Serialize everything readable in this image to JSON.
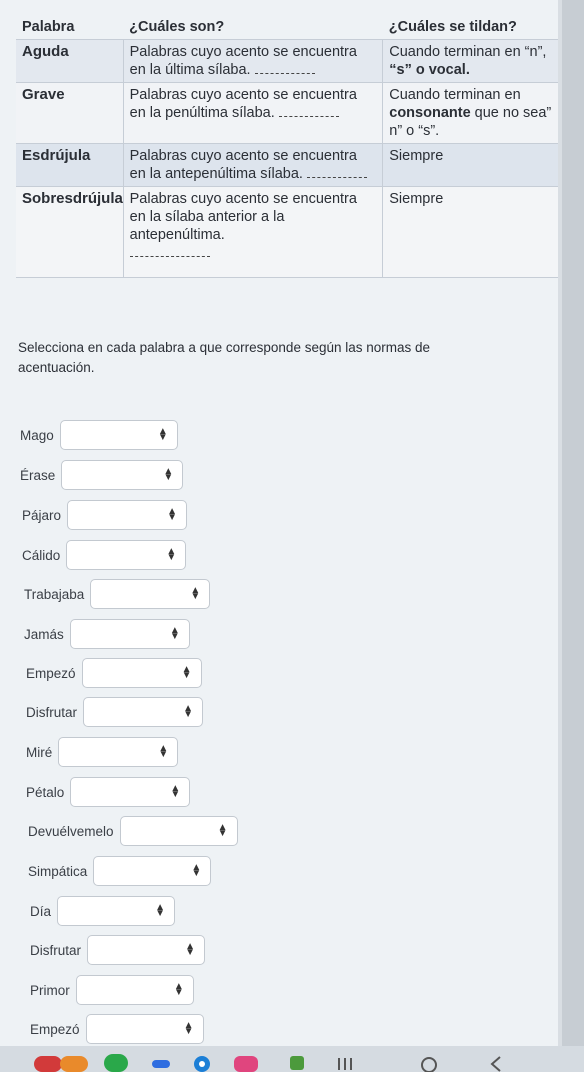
{
  "table": {
    "headers": [
      "Palabra",
      "¿Cuáles son?",
      "¿Cuáles se tildan?"
    ],
    "rows": [
      {
        "word": "Aguda",
        "desc": "Palabras cuyo acento se encuentra en la última sílaba.",
        "rule_a": "Cuando terminan en “n”,",
        "rule_b": "“s” o vocal."
      },
      {
        "word": "Grave",
        "desc": "Palabras cuyo acento se encuentra en la penúltima sílaba.",
        "rule_a": "Cuando terminan en",
        "rule_strong": "consonante",
        "rule_b": "que no sea” n” o “s”."
      },
      {
        "word": "Esdrújula",
        "desc": "Palabras cuyo acento se encuentra en la antepenúltima sílaba.",
        "rule_a": "Siempre"
      },
      {
        "word": "Sobresdrújula",
        "desc": "Palabras cuyo acento se encuentra en la sílaba anterior a la antepenúltima.",
        "rule_a": "Siempre"
      }
    ]
  },
  "instructions": "Selecciona en cada palabra a que corresponde según las normas de acentuación.",
  "questions": [
    {
      "label": "Mago",
      "value": ""
    },
    {
      "label": "Érase",
      "value": ""
    },
    {
      "label": "Pájaro",
      "value": ""
    },
    {
      "label": "Cálido",
      "value": ""
    },
    {
      "label": "Trabajaba",
      "value": ""
    },
    {
      "label": "Jamás",
      "value": ""
    },
    {
      "label": "Empezó",
      "value": ""
    },
    {
      "label": "Disfrutar",
      "value": ""
    },
    {
      "label": "Miré",
      "value": ""
    },
    {
      "label": "Pétalo",
      "value": ""
    },
    {
      "label": "Devuélvemelo",
      "value": ""
    },
    {
      "label": "Simpática",
      "value": ""
    },
    {
      "label": "Día",
      "value": ""
    },
    {
      "label": "Disfrutar",
      "value": ""
    },
    {
      "label": "Primor",
      "value": ""
    },
    {
      "label": "Empezó",
      "value": ""
    }
  ],
  "dock": {
    "icons": [
      "app-red-icon",
      "app-orange-icon",
      "app-green-icon",
      "app-blue-dot-icon",
      "app-circle-icon",
      "app-pink-icon",
      "app-lock-icon",
      "recents-icon",
      "home-icon",
      "back-icon"
    ],
    "colors": [
      "#d23a3a",
      "#e98a2b",
      "#2aa84a",
      "#2f6de0",
      "#1c7fd6",
      "#e0457e",
      "#4c9a3c",
      "#555555",
      "#555555",
      "#555555"
    ]
  }
}
